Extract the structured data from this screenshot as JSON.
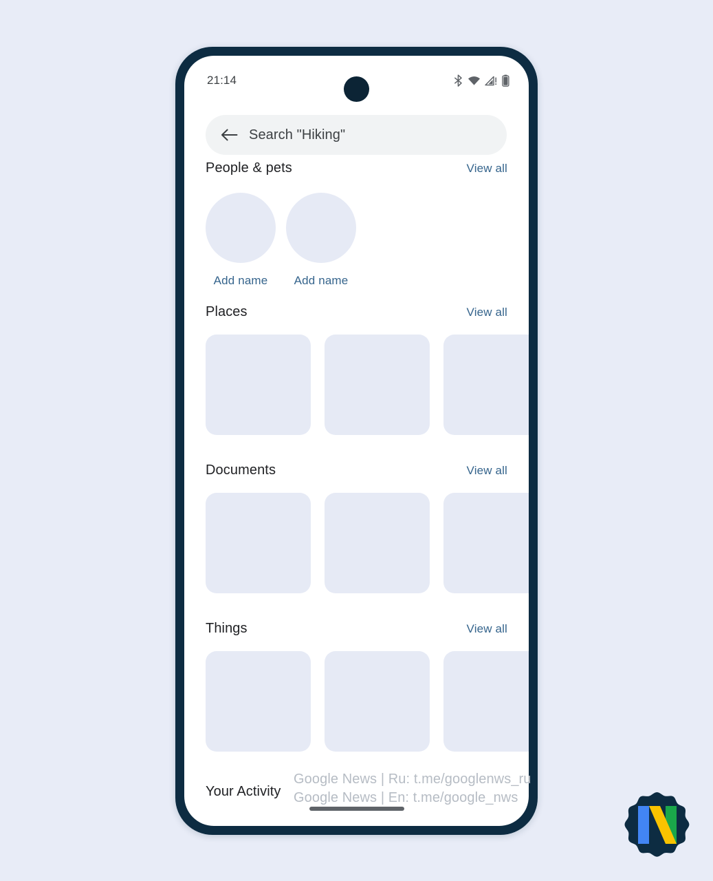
{
  "page": {
    "background_color": "#e8ecf7"
  },
  "device": {
    "frame_color": "#0d2c42",
    "screen_background": "#ffffff",
    "camera_icon": "camera-punch-hole"
  },
  "status_bar": {
    "time": "21:14",
    "icons": [
      {
        "name": "bluetooth-icon",
        "label": "Bluetooth"
      },
      {
        "name": "wifi-icon",
        "label": "Wi-Fi"
      },
      {
        "name": "cellular-signal-warning-icon",
        "label": "No SIM / signal warning"
      },
      {
        "name": "battery-icon",
        "label": "Battery"
      }
    ]
  },
  "search": {
    "back_icon": "arrow-left-icon",
    "query": "Search \"Hiking\"",
    "placeholder": "Search \"Hiking\"",
    "background_color": "#f1f3f4"
  },
  "colors": {
    "link_blue": "#35648c",
    "tile_placeholder": "#e6eaf5",
    "heading_text": "#202124",
    "watermark_gray": "#b6bcc4"
  },
  "sections": [
    {
      "id": "people",
      "title": "People & pets",
      "view_all_label": "View all",
      "people": [
        {
          "label": "Add name"
        },
        {
          "label": "Add name"
        }
      ]
    },
    {
      "id": "places",
      "title": "Places",
      "view_all_label": "View all",
      "tile_count": 3
    },
    {
      "id": "documents",
      "title": "Documents",
      "view_all_label": "View all",
      "tile_count": 3
    },
    {
      "id": "things",
      "title": "Things",
      "view_all_label": "View all",
      "tile_count": 3
    }
  ],
  "activity": {
    "title": "Your Activity"
  },
  "watermark": {
    "line1": "Google News | Ru: t.me/googlenws_ru",
    "line2": "Google News | En: t.me/google_nws"
  },
  "logo": {
    "name": "google-news-badge-logo",
    "letter": "N",
    "badge_color": "#0d2c42",
    "bar_blue": "#4285f4",
    "bar_yellow": "#f9c300",
    "bar_green": "#1aa74a"
  }
}
